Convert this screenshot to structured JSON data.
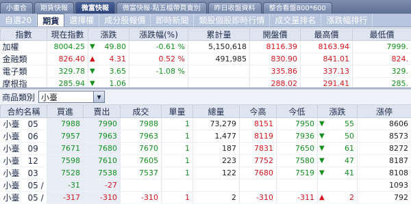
{
  "top_tabs": [
    "小畫合",
    "期貨快報",
    "微富快報",
    "微富快報-點五檔帶買賣別",
    "昨日收盤資料",
    "整合看盤800*600"
  ],
  "top_tab_active": 2,
  "sub_tabs": [
    "自選20",
    "期貨",
    "選擇權",
    "成分股報價",
    "即時新聞",
    "類股個股即時行情",
    "成交量排名",
    "漲跌幅排行"
  ],
  "sub_tab_active": 1,
  "quote": {
    "headers": [
      "指數",
      "現在指數",
      "漲跌",
      "漲跌幅(%)",
      "累計量",
      "開盤價",
      "最高價",
      "最低價"
    ],
    "rows": [
      {
        "name": "加權",
        "index": "8004.25",
        "dir": "down",
        "change": "49.80",
        "pct": "-0.61 %",
        "vol": "5,150,618",
        "open": "8116.39",
        "high": "8163.94",
        "low": "7999."
      },
      {
        "name": "金融類",
        "index": "826.40",
        "dir": "up",
        "change": "4.31",
        "pct": "0.52 %",
        "vol": "491,985",
        "open": "830.90",
        "high": "841.01",
        "low": "824."
      },
      {
        "name": "電子類",
        "index": "329.78",
        "dir": "down",
        "change": "3.65",
        "pct": "-1.08 %",
        "vol": "",
        "open": "335.86",
        "high": "337.13",
        "low": "329."
      },
      {
        "name": "摩根指",
        "index": "285.94",
        "dir": "down",
        "change": "1.06",
        "pct": "",
        "vol": "",
        "open": "288.02",
        "high": "291.41",
        "low": "285."
      }
    ]
  },
  "selector": {
    "label": "商品類別",
    "value": "小臺"
  },
  "futures": {
    "headers": [
      "合約名稱",
      "買進",
      "賣出",
      "成交",
      "單量",
      "總量",
      "今高",
      "今低",
      "漲跌",
      "漲停"
    ],
    "rows": [
      {
        "name": "小臺　05",
        "bid": "7988",
        "ask": "7990",
        "last": "7988",
        "qty": "1",
        "total": "73,279",
        "high": "8151",
        "low": "7950",
        "dir": "down",
        "chg": "55",
        "limit": "8606"
      },
      {
        "name": "小臺　06",
        "bid": "7957",
        "ask": "7963",
        "last": "7963",
        "qty": "1",
        "total": "1,477",
        "high": "8119",
        "low": "7936",
        "dir": "down",
        "chg": "50",
        "limit": "8573"
      },
      {
        "name": "小臺　09",
        "bid": "7671",
        "ask": "7680",
        "last": "7670",
        "qty": "1",
        "total": "187",
        "high": "7831",
        "low": "7650",
        "dir": "down",
        "chg": "61",
        "limit": "8272"
      },
      {
        "name": "小臺　12",
        "bid": "7598",
        "ask": "7610",
        "last": "7605",
        "qty": "1",
        "total": "223",
        "high": "7752",
        "low": "7580",
        "dir": "down",
        "chg": "47",
        "limit": "8187"
      },
      {
        "name": "小臺　03",
        "bid": "7528",
        "ask": "7538",
        "last": "7537",
        "qty": "1",
        "total": "122",
        "high": "7680",
        "low": "7519",
        "dir": "down",
        "chg": "41",
        "limit": "8108"
      },
      {
        "name": "小臺　05 /",
        "bid": "-31",
        "ask": "-27",
        "last": "",
        "qty": "",
        "total": "",
        "high": "",
        "low": "",
        "dir": "",
        "chg": "",
        "limit": "1093"
      },
      {
        "name": "小臺　05 /",
        "bid": "-317",
        "ask": "-310",
        "last": "-310",
        "qty": "1",
        "total": "2",
        "high": "-310",
        "low": "-311",
        "dir": "up",
        "chg": "2",
        "limit": "792"
      }
    ]
  },
  "colors": {
    "up": "#d8141a",
    "down": "#11911c"
  },
  "icons": {
    "up": "triangle-up-icon",
    "down": "triangle-down-icon",
    "dropdown": "chevron-down-icon"
  }
}
